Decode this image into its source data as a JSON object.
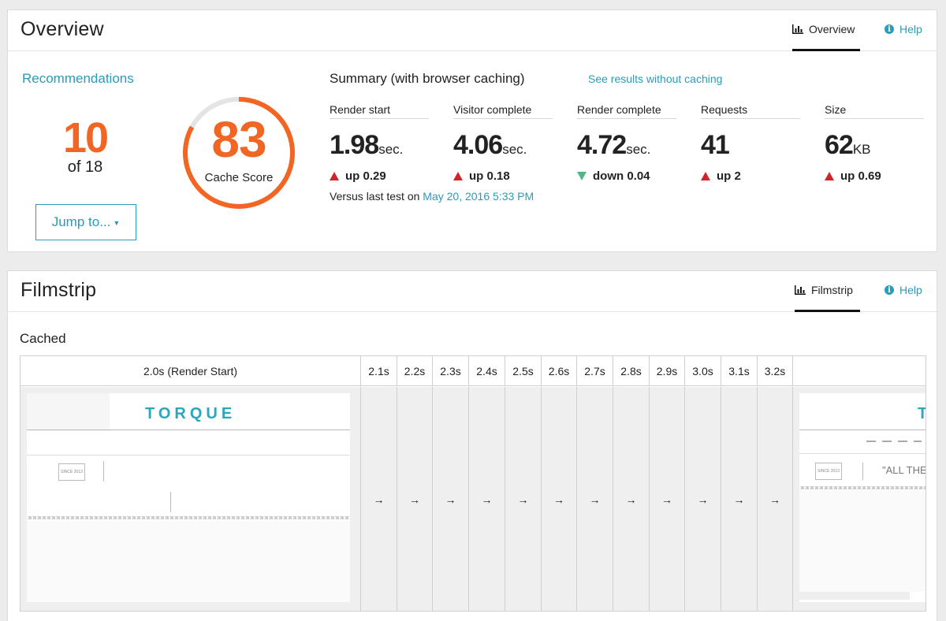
{
  "overview": {
    "title": "Overview",
    "tab_label": "Overview",
    "help_label": "Help",
    "recommendations": {
      "title": "Recommendations",
      "count": "10",
      "of_text": "of 18",
      "jump_label": "Jump to..."
    },
    "cache_score": {
      "value": "83",
      "label": "Cache Score",
      "fraction": 0.83
    },
    "summary": {
      "title": "Summary (with browser caching)",
      "link": "See results without caching",
      "metrics": [
        {
          "label": "Render start",
          "value": "1.98",
          "unit": "sec.",
          "change": "up 0.29",
          "direction": "up"
        },
        {
          "label": "Visitor complete",
          "value": "4.06",
          "unit": "sec.",
          "change": "up 0.18",
          "direction": "up"
        },
        {
          "label": "Render complete",
          "value": "4.72",
          "unit": "sec.",
          "change": "down 0.04",
          "direction": "down"
        },
        {
          "label": "Requests",
          "value": "41",
          "unit": "",
          "change": "up 2",
          "direction": "up"
        },
        {
          "label": "Size",
          "value": "62",
          "unit": "KB",
          "change": "up 0.69",
          "direction": "up"
        }
      ],
      "versus_prefix": "Versus last test on",
      "versus_date": "May 20, 2016 5:33 PM"
    },
    "colors": {
      "accent": "#2a9cb6",
      "score": "#f26522",
      "up": "#d0242a",
      "down": "#4cb884"
    }
  },
  "filmstrip": {
    "title": "Filmstrip",
    "tab_label": "Filmstrip",
    "help_label": "Help",
    "section_label": "Cached",
    "first_frame_label": "2.0s (Render Start)",
    "frames": [
      "2.1s",
      "2.2s",
      "2.3s",
      "2.4s",
      "2.5s",
      "2.6s",
      "2.7s",
      "2.8s",
      "2.9s",
      "3.0s",
      "3.1s",
      "3.2s"
    ],
    "arrow": "→",
    "thumb_logo": "TORQUE",
    "thumb_badge": "SINCE 2013",
    "last_thumb_quote": "\"ALL THE V"
  }
}
